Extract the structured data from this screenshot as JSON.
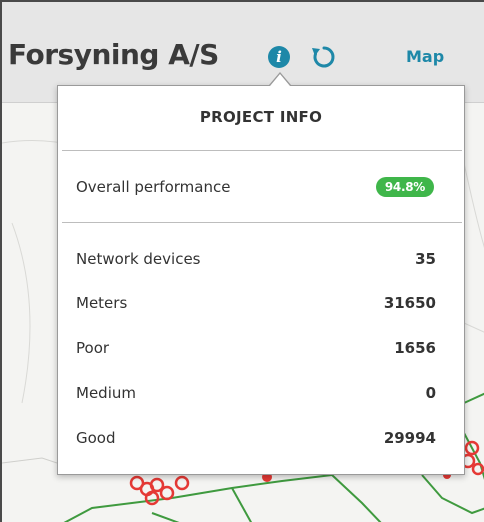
{
  "header": {
    "title": "Forsyning A/S",
    "info_icon": "info-icon",
    "info_glyph": "i",
    "refresh_icon": "refresh-icon",
    "map_link": "Map"
  },
  "popover": {
    "title": "PROJECT INFO",
    "performance": {
      "label": "Overall performance",
      "value": "94.8%",
      "badge_color": "#3fb64a"
    },
    "stats": [
      {
        "label": "Network devices",
        "value": "35"
      },
      {
        "label": "Meters",
        "value": "31650"
      },
      {
        "label": "Poor",
        "value": "1656"
      },
      {
        "label": "Medium",
        "value": "0"
      },
      {
        "label": "Good",
        "value": "29994"
      }
    ]
  },
  "colors": {
    "accent": "#1e88a8",
    "header_bg": "#e6e6e6",
    "map_road": "#3f9a3f",
    "map_marker": "#e53935"
  }
}
